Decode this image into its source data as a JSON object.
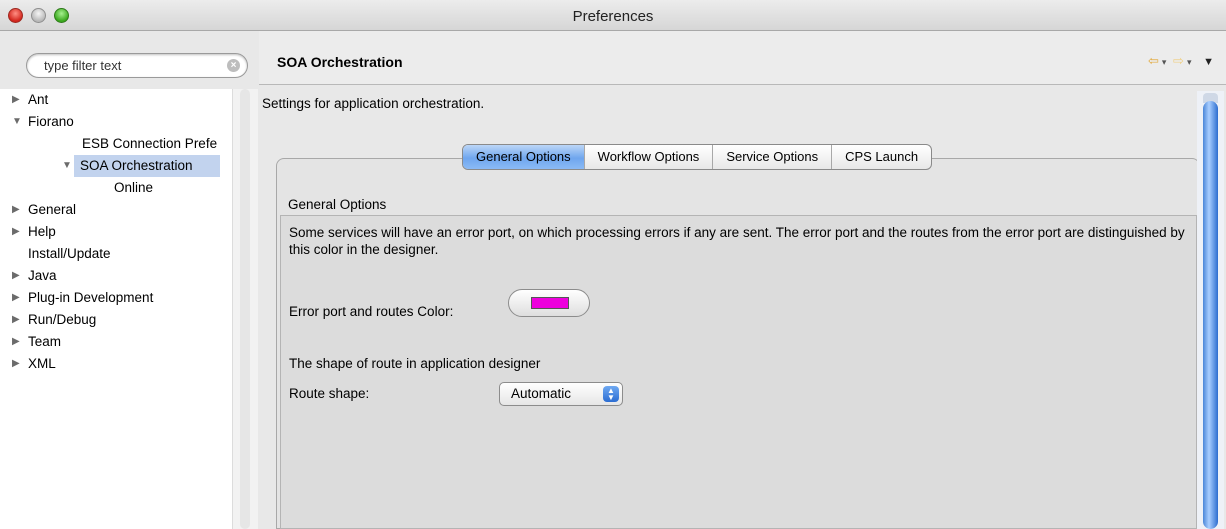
{
  "window": {
    "title": "Preferences"
  },
  "sidebar": {
    "filter_placeholder": "type filter text",
    "items": [
      {
        "label": "Ant",
        "arrow": "▶"
      },
      {
        "label": "Fiorano",
        "arrow": "▼"
      },
      {
        "label": "ESB Connection Prefe",
        "arrow": ""
      },
      {
        "label": "SOA Orchestration",
        "arrow": "▼"
      },
      {
        "label": "Online",
        "arrow": ""
      },
      {
        "label": "General",
        "arrow": "▶"
      },
      {
        "label": "Help",
        "arrow": "▶"
      },
      {
        "label": "Install/Update",
        "arrow": ""
      },
      {
        "label": "Java",
        "arrow": "▶"
      },
      {
        "label": "Plug-in Development",
        "arrow": "▶"
      },
      {
        "label": "Run/Debug",
        "arrow": "▶"
      },
      {
        "label": "Team",
        "arrow": "▶"
      },
      {
        "label": "XML",
        "arrow": "▶"
      }
    ]
  },
  "main": {
    "title": "SOA Orchestration",
    "description": "Settings for application orchestration.",
    "tabs": [
      {
        "label": "General Options",
        "active": true
      },
      {
        "label": "Workflow Options",
        "active": false
      },
      {
        "label": "Service Options",
        "active": false
      },
      {
        "label": "CPS Launch",
        "active": false
      }
    ],
    "group": {
      "label": "General Options",
      "error_text": "Some services will have an error port, on which processing errors if any are sent. The error port and the routes from the error port are distinguished by this color in the designer.",
      "color_label": "Error port and routes Color:",
      "color_value": "#ee00dd",
      "shape_text": "The shape of route in application designer",
      "shape_label": "Route shape:",
      "shape_value": "Automatic"
    }
  },
  "icons": {
    "back": "back-arrow-icon",
    "forward": "forward-arrow-icon",
    "menu": "view-menu-icon"
  }
}
